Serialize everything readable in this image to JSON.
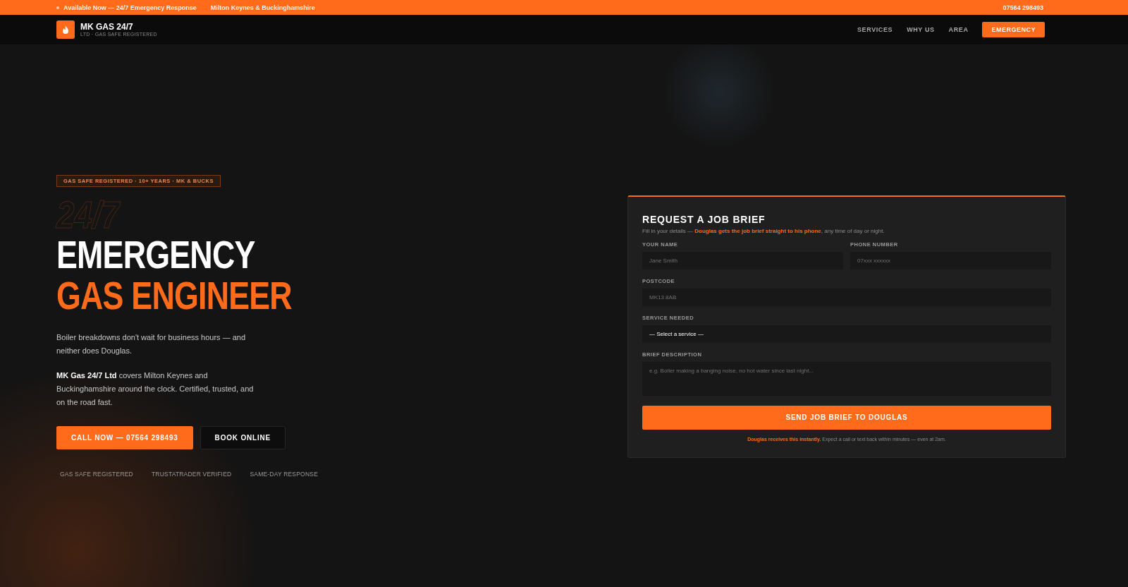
{
  "top_bar": {
    "availability": "Available Now — 24/7 Emergency Response",
    "area": "Milton Keynes & Buckinghamshire",
    "phone": "07564 298493"
  },
  "nav": {
    "logo_title": "MK GAS 24/7",
    "logo_subtitle": "LTD · GAS SAFE REGISTERED",
    "links": [
      {
        "label": "SERVICES",
        "kind": "link"
      },
      {
        "label": "WHY US",
        "kind": "link"
      },
      {
        "label": "AREA",
        "kind": "link"
      },
      {
        "label": "EMERGENCY",
        "kind": "cta"
      }
    ]
  },
  "hero": {
    "badge": "GAS SAFE REGISTERED · 10+ YEARS · MK & BUCKS",
    "outline_title": "24/7",
    "title_line_1": "EMERGENCY",
    "title_line_2": "GAS ENGINEER",
    "paragraphs": [
      "Boiler breakdowns don't wait for business hours — and neither does Douglas.",
      "**MK Gas 24/7 Ltd** covers Milton Keynes and Buckinghamshire around the clock. Certified, trusted, and on the road fast."
    ],
    "buttons": [
      {
        "label": "CALL NOW — 07564 298493",
        "kind": "primary"
      },
      {
        "label": "BOOK ONLINE",
        "kind": "secondary"
      }
    ],
    "trust_items": [
      "GAS SAFE REGISTERED",
      "TRUSTATRADER VERIFIED",
      "SAME-DAY RESPONSE"
    ]
  },
  "form": {
    "title": "REQUEST A JOB BRIEF",
    "intro": "Fill in your details — **Douglas gets the job brief straight to his phone**, any time of day or night.",
    "fields": [
      {
        "label": "YOUR NAME",
        "placeholder": "Jane Smith",
        "kind": "input",
        "half": true
      },
      {
        "label": "PHONE NUMBER",
        "placeholder": "07xxx xxxxxx",
        "kind": "input",
        "half": true
      },
      {
        "label": "POSTCODE",
        "placeholder": "MK13 8AB",
        "kind": "input",
        "half": false
      },
      {
        "label": "SERVICE NEEDED",
        "value": "— Select a service —",
        "kind": "select",
        "half": false
      },
      {
        "label": "BRIEF DESCRIPTION",
        "placeholder": "e.g. Boiler making a banging noise, no hot water since last night...",
        "kind": "textarea",
        "half": false
      }
    ],
    "submit": "SEND JOB BRIEF TO DOUGLAS",
    "note": "**Douglas receives this instantly.** Expect a call or text back within minutes — even at 2am."
  }
}
